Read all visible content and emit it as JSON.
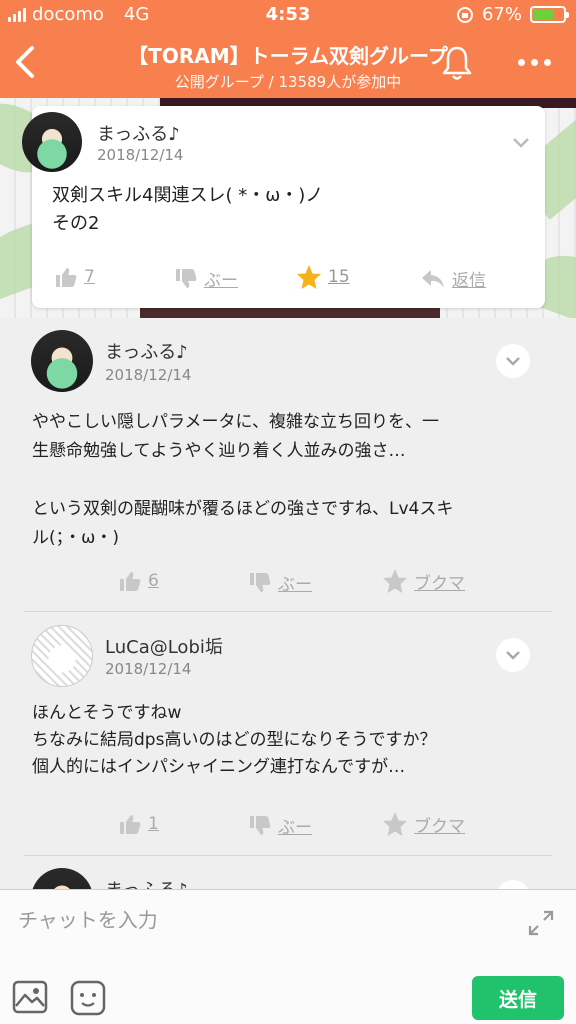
{
  "status": {
    "carrier": "docomo",
    "network": "4G",
    "time": "4:53",
    "battery": "67%",
    "battery_level": 0.67
  },
  "header": {
    "title": "【TORAM】トーラム双剣グループ",
    "subtitle": "公開グループ / 13589人が参加中"
  },
  "post": {
    "author": "まっふる♪",
    "date": "2018/12/14",
    "body": "双剣スキル4関連スレ( *・ω・)ノ\nその2",
    "likes": "7",
    "boo": "ぶー",
    "stars": "15",
    "reply": "返信"
  },
  "comments": [
    {
      "author": "まっふる♪",
      "date": "2018/12/14",
      "body": "ややこしい隠しパラメータに、複雑な立ち回りを、一\n生懸命勉強してようやく辿り着く人並みの強さ…\n\nという双剣の醍醐味が覆るほどの強さですね、Lv4スキ\nル(；・ω・)",
      "likes": "6",
      "boo": "ぶー",
      "bookmark": "ブクマ"
    },
    {
      "author": "LuCa@Lobi垢",
      "date": "2018/12/14",
      "body": "ほんとそうですねw\nちなみに結局dps高いのはどの型になりそうですか？\n個人的にはインパシャイニング連打なんですが…",
      "likes": "1",
      "boo": "ぶー",
      "bookmark": "ブクマ"
    },
    {
      "author": "まっふる♪"
    }
  ],
  "input": {
    "placeholder": "チャットを入力",
    "send_label": "送信"
  },
  "colors": {
    "header": "#f8804e",
    "accent_star": "#f5b21b",
    "send": "#20c36b"
  }
}
